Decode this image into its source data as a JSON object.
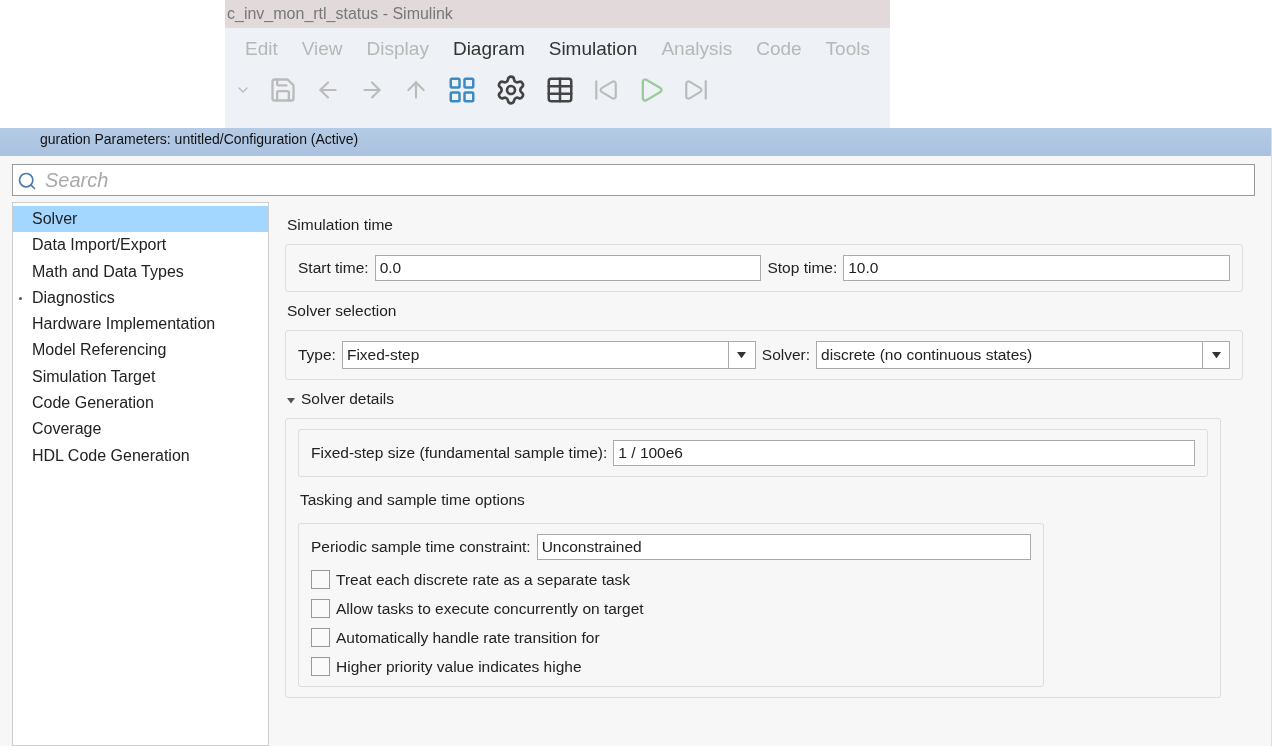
{
  "simulink_window": {
    "title": "c_inv_mon_rtl_status - Simulink",
    "menu": [
      {
        "label": "Edit"
      },
      {
        "label": "View"
      },
      {
        "label": "Display"
      },
      {
        "label": "Diagram"
      },
      {
        "label": "Simulation"
      },
      {
        "label": "Analysis"
      },
      {
        "label": "Code"
      },
      {
        "label": "Tools"
      }
    ]
  },
  "dialog": {
    "title": "guration Parameters: untitled/Configuration (Active)",
    "search": {
      "placeholder": "Search"
    },
    "sidebar": {
      "items": [
        {
          "label": "Solver",
          "selected": true
        },
        {
          "label": "Data Import/Export",
          "selected": false
        },
        {
          "label": "Math and Data Types",
          "selected": false
        },
        {
          "label": "Diagnostics",
          "selected": false,
          "expandable": true
        },
        {
          "label": "Hardware Implementation",
          "selected": false
        },
        {
          "label": "Model Referencing",
          "selected": false
        },
        {
          "label": "Simulation Target",
          "selected": false
        },
        {
          "label": "Code Generation",
          "selected": false
        },
        {
          "label": "Coverage",
          "selected": false
        },
        {
          "label": "HDL Code Generation",
          "selected": false
        }
      ]
    },
    "simulation_time": {
      "heading": "Simulation time",
      "start_label": "Start time:",
      "start_value": "0.0",
      "stop_label": "Stop time:",
      "stop_value": "10.0"
    },
    "solver_selection": {
      "heading": "Solver selection",
      "type_label": "Type:",
      "type_value": "Fixed-step",
      "solver_label": "Solver:",
      "solver_value": "discrete (no continuous states)"
    },
    "solver_details": {
      "heading": "Solver details",
      "expanded": true,
      "step_label": "Fixed-step size (fundamental sample time):",
      "step_value": "1 / 100e6",
      "tasking_heading": "Tasking and sample time options",
      "constraint_label": "Periodic sample time constraint:",
      "constraint_value": "Unconstrained",
      "options": [
        {
          "label": "Treat each discrete rate as a separate task",
          "checked": false
        },
        {
          "label": "Allow tasks to execute concurrently on target",
          "checked": false
        },
        {
          "label": "Automatically handle rate transition for",
          "checked": false
        },
        {
          "label": "Higher priority value indicates highe",
          "checked": false
        }
      ]
    }
  }
}
